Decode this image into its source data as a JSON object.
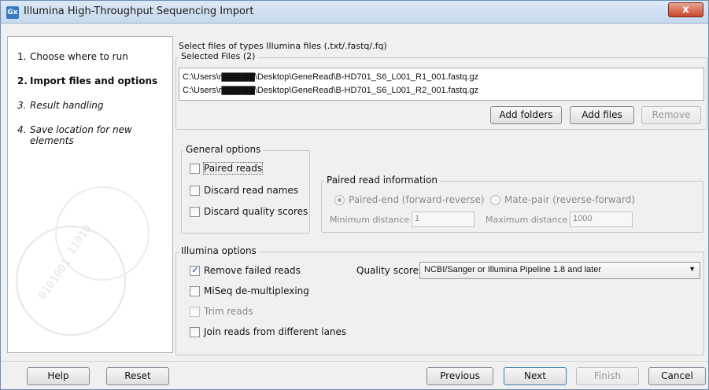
{
  "window": {
    "title": "Illumina High-Throughput Sequencing Import",
    "app_icon": "Gx",
    "close_icon": "x"
  },
  "sidebar": {
    "steps": [
      {
        "num": "1.",
        "label": "Choose where to run"
      },
      {
        "num": "2.",
        "label": "Import files and options"
      },
      {
        "num": "3.",
        "label": "Result handling"
      },
      {
        "num": "4.",
        "label": "Save location for new elements"
      }
    ]
  },
  "main": {
    "select_hint": "Select files of types Illumina files (.txt/.fastq/.fq)",
    "selected_files_title": "Selected Files (2)",
    "files": [
      "C:\\Users\\r▇▇▇▇▇\\Desktop\\GeneRead\\B-HD701_S6_L001_R1_001.fastq.gz",
      "C:\\Users\\r▇▇▇▇▇\\Desktop\\GeneRead\\B-HD701_S6_L001_R2_001.fastq.gz"
    ],
    "buttons": {
      "add_folders": "Add folders",
      "add_files": "Add files",
      "remove": "Remove"
    },
    "general_options": {
      "title": "General options",
      "paired_reads": "Paired reads",
      "discard_read_names": "Discard read names",
      "discard_quality_scores": "Discard quality scores"
    },
    "paired_info": {
      "title": "Paired read information",
      "paired_end": "Paired-end (forward-reverse)",
      "mate_pair": "Mate-pair (reverse-forward)",
      "min_distance_label": "Minimum distance",
      "min_distance_value": "1",
      "max_distance_label": "Maximum distance",
      "max_distance_value": "1000"
    },
    "illumina_options": {
      "title": "Illumina options",
      "remove_failed_reads": "Remove failed reads",
      "miseq": "MiSeq de-multiplexing",
      "trim_reads": "Trim reads",
      "join_reads": "Join reads from different lanes",
      "quality_scores_label": "Quality scores",
      "quality_scores_value": "NCBI/Sanger or Illumina Pipeline 1.8 and later"
    }
  },
  "footer": {
    "help": "Help",
    "reset": "Reset",
    "previous": "Previous",
    "next": "Next",
    "finish": "Finish",
    "cancel": "Cancel"
  }
}
